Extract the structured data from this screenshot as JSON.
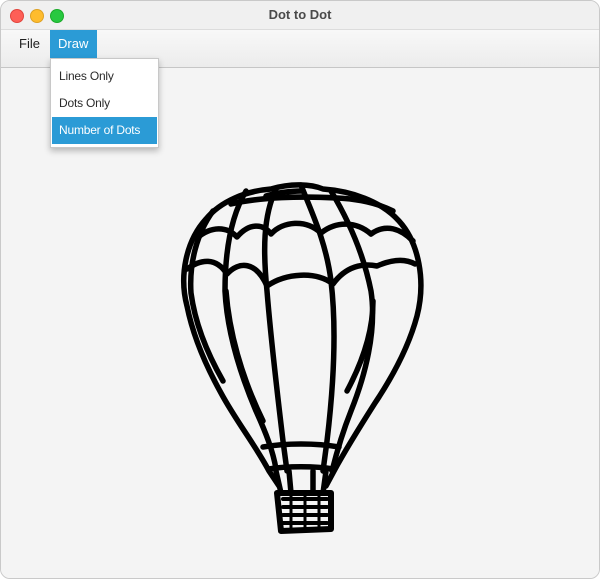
{
  "window": {
    "title": "Dot to Dot"
  },
  "menubar": {
    "file_label": "File",
    "draw_label": "Draw"
  },
  "draw_menu": {
    "items": [
      {
        "label": "Lines Only",
        "selected": false
      },
      {
        "label": "Dots Only",
        "selected": false
      },
      {
        "label": "Number of Dots",
        "selected": true
      }
    ]
  },
  "colors": {
    "accent": "#2b9bd6",
    "close": "#fe5f57",
    "minimize": "#febc2e",
    "zoom": "#28c840",
    "stroke": "#000000"
  }
}
